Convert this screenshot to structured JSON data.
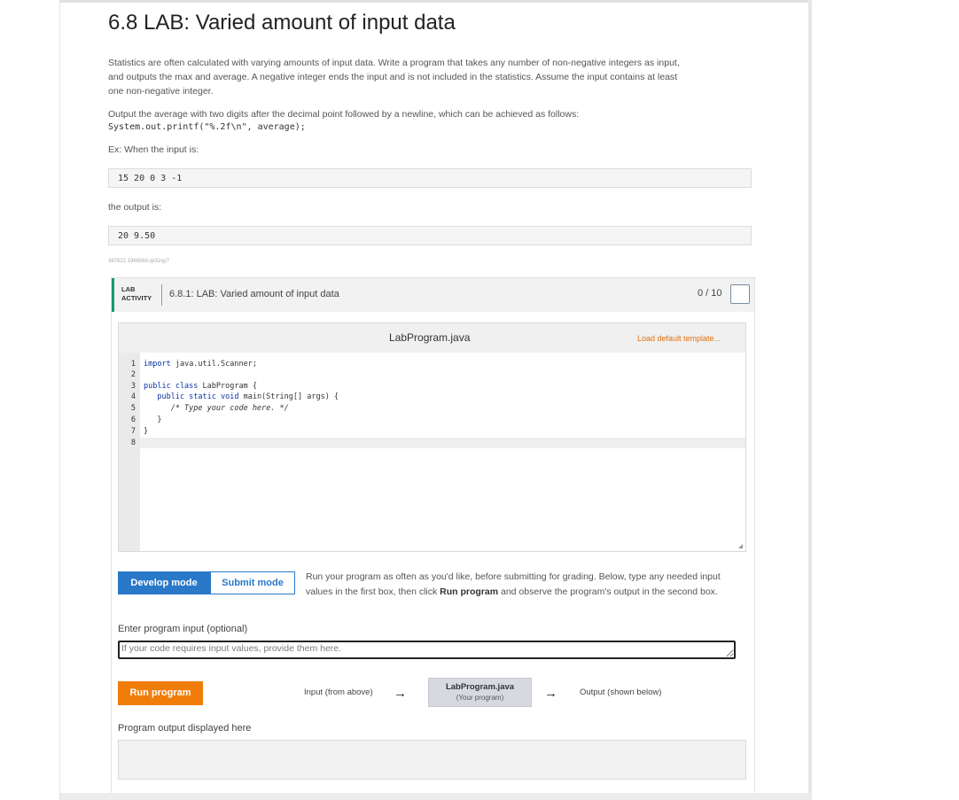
{
  "page": {
    "title": "6.8 LAB: Varied amount of input data",
    "description_1": "Statistics are often calculated with varying amounts of input data. Write a program that takes any number of non-negative integers as input,",
    "description_2": "and outputs the max and average. A negative integer ends the input and is not included in the statistics. Assume the input contains at least",
    "description_3": "one non-negative integer.",
    "output_instruction": "Output the average with two digits after the decimal point followed by a newline, which can be achieved as follows:",
    "printf_code": "System.out.printf(\"%.2f\\n\", average);",
    "example_label": "Ex: When the input is:",
    "example_input": "15 20 0 3 -1",
    "output_label": "the output is:",
    "example_output": "20 9.50",
    "code_id": "367622.1966560.qx3zqy7"
  },
  "activity": {
    "tag_line1": "LAB",
    "tag_line2": "ACTIVITY",
    "title": "6.8.1: LAB: Varied amount of input data",
    "score": "0 / 10"
  },
  "editor": {
    "filename": "LabProgram.java",
    "load_template": "Load default template...",
    "line_numbers": [
      "1",
      "2",
      "3",
      "4",
      "5",
      "6",
      "7",
      "8"
    ],
    "lines": {
      "l1_kw": "import",
      "l1_rest": " java.util.Scanner;",
      "l3_kw": "public class",
      "l3_rest": " LabProgram {",
      "l4_kw": "   public static void",
      "l4_rest": " main(String[] args) {",
      "l5": "      /* Type your code here. */",
      "l6": "   }",
      "l7": "}"
    }
  },
  "modes": {
    "develop": "Develop mode",
    "submit": "Submit mode",
    "description_before": "Run your program as often as you'd like, before submitting for grading. Below, type any needed input values in the first box, then click ",
    "description_bold": "Run program",
    "description_after": " and observe the program's output in the second box."
  },
  "run": {
    "input_label": "Enter program input (optional)",
    "input_placeholder": "If your code requires input values, provide them here.",
    "button": "Run program",
    "flow_input": "Input (from above)",
    "program_name": "LabProgram.java",
    "program_sub": "(Your program)",
    "flow_output": "Output (shown below)",
    "output_label": "Program output displayed here"
  },
  "icons": {
    "arrow": "→"
  }
}
